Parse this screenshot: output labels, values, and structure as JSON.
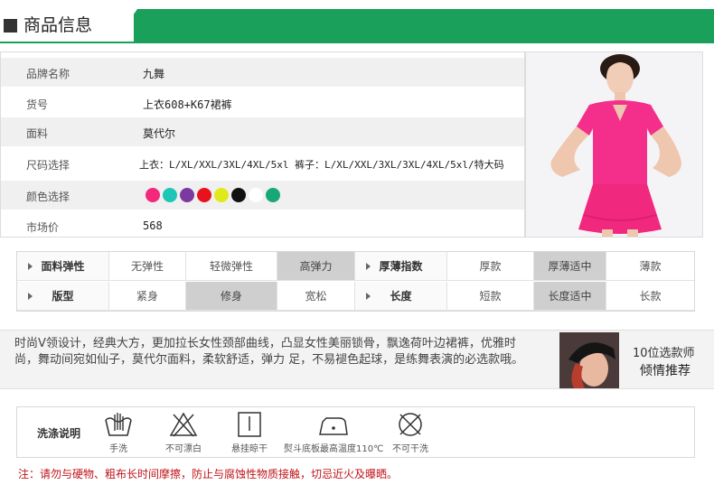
{
  "header": {
    "title": "商品信息"
  },
  "info_rows": [
    {
      "label": "品牌名称",
      "value": "九舞"
    },
    {
      "label": "货号",
      "value": "上衣608+K67裙裤"
    },
    {
      "label": "面料",
      "value": "莫代尔"
    },
    {
      "label": "尺码选择",
      "value": "上衣：L/XL/XXL/3XL/4XL/5xl",
      "value2": "裤子：L/XL/XXL/3XL/3XL/4XL/5xl/特大码"
    },
    {
      "label": "颜色选择"
    },
    {
      "label": "市场价",
      "value": "568"
    }
  ],
  "colors": [
    "#f4287a",
    "#1ec6b8",
    "#7a3aa0",
    "#e8121c",
    "#e0ea1a",
    "#111111",
    "#ffffff",
    "#18a878"
  ],
  "attributes": {
    "row1": {
      "label_a": "面料弹性",
      "opts_a": [
        "无弹性",
        "轻微弹性",
        "高弹力"
      ],
      "sel_a": 2,
      "label_b": "厚薄指数",
      "opts_b": [
        "厚款",
        "厚薄适中",
        "薄款"
      ],
      "sel_b": 1
    },
    "row2": {
      "label_a": "版型",
      "opts_a": [
        "紧身",
        "修身",
        "宽松"
      ],
      "sel_a": 1,
      "label_b": "长度",
      "opts_b": [
        "短款",
        "长度适中",
        "长款"
      ],
      "sel_b": 1
    }
  },
  "description": {
    "text": "时尚V领设计，经典大方，更加拉长女性颈部曲线，凸显女性美丽锁骨，飘逸荷叶边裙裤，优雅时尚，舞动间宛如仙子，莫代尔面料，柔软舒适，弹力  足，不易褪色起球，是练舞表演的必选款哦。",
    "recommend_line1": "10位选款师",
    "recommend_line2": "倾情推荐"
  },
  "care": {
    "title": "洗涤说明",
    "items": [
      {
        "icon": "hand-wash-icon",
        "label": "手洗"
      },
      {
        "icon": "no-bleach-icon",
        "label": "不可漂白"
      },
      {
        "icon": "hang-dry-icon",
        "label": "悬挂晾干"
      },
      {
        "icon": "iron-icon",
        "label": "熨斗底板最高温度110℃"
      },
      {
        "icon": "no-dry-clean-icon",
        "label": "不可干洗"
      }
    ]
  },
  "note": "注：请勿与硬物、粗布长时间摩擦，防止与腐蚀性物质接触，切忌近火及曝晒。"
}
